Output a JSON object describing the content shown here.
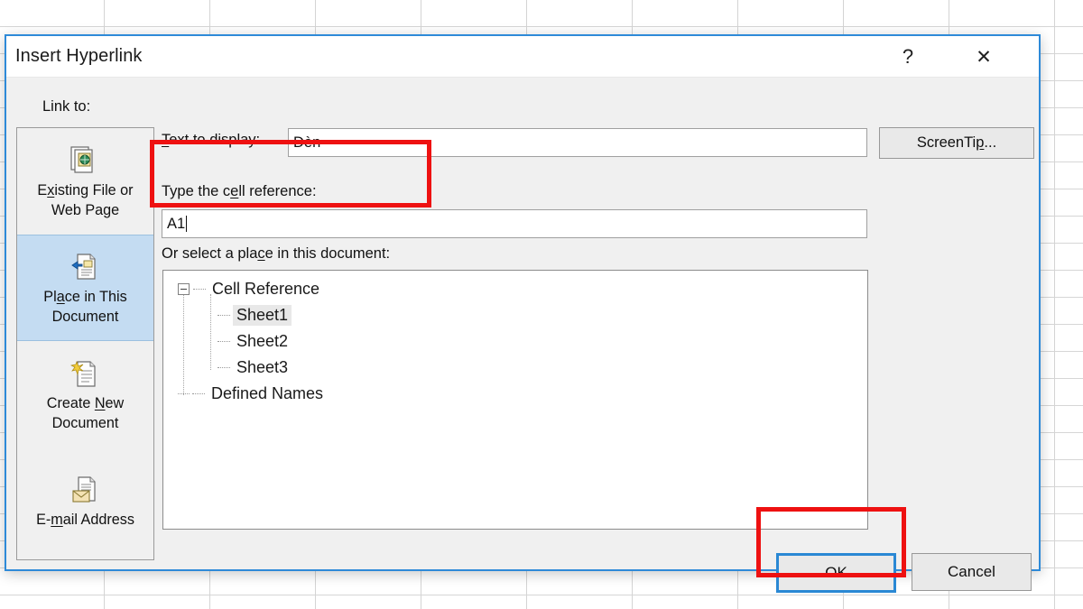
{
  "window": {
    "title": "Insert Hyperlink",
    "help_icon": "?",
    "close_icon": "✕"
  },
  "sidebar": {
    "label": "Link to:",
    "items": [
      {
        "label_pre": "E",
        "label_accel": "x",
        "label_post": "isting File or\nWeb Page",
        "icon": "existing-file-or-web-page-icon",
        "selected": false
      },
      {
        "label_pre": "Pl",
        "label_accel": "a",
        "label_post": "ce in This\nDocument",
        "icon": "place-in-this-document-icon",
        "selected": true
      },
      {
        "label_pre": "Create ",
        "label_accel": "N",
        "label_post": "ew\nDocument",
        "icon": "create-new-document-icon",
        "selected": false
      },
      {
        "label_pre": "E-",
        "label_accel": "m",
        "label_post": "ail Address",
        "icon": "email-address-icon",
        "selected": false
      }
    ]
  },
  "form": {
    "text_to_display": {
      "label_pre": "",
      "label_accel": "T",
      "label_post": "ext to display:",
      "value": "Đèn",
      "placeholder": ""
    },
    "screentip_button": {
      "label_pre": "ScreenTi",
      "label_accel": "p",
      "label_post": "..."
    },
    "cell_reference": {
      "label_pre": "Type the c",
      "label_accel": "e",
      "label_post": "ll reference:",
      "value": "A1",
      "placeholder": ""
    },
    "or_select": {
      "label_pre": "Or select a pla",
      "label_accel": "c",
      "label_post": "e in this document:"
    }
  },
  "tree": {
    "root": {
      "label": "Cell Reference",
      "expanded": true
    },
    "children": [
      {
        "label": "Sheet1",
        "selected": true
      },
      {
        "label": "Sheet2",
        "selected": false
      },
      {
        "label": "Sheet3",
        "selected": false
      }
    ],
    "defined_names": {
      "label": "Defined Names"
    }
  },
  "buttons": {
    "ok": "OK",
    "cancel": "Cancel"
  },
  "colors": {
    "dialog_border": "#2e8ad8",
    "dialog_face": "#f0f0f0",
    "selected_rail": "#c4dcf2",
    "focus_border": "#2a88d4",
    "annotation": "#ee1111",
    "grid_line": "#d4d4d4"
  }
}
